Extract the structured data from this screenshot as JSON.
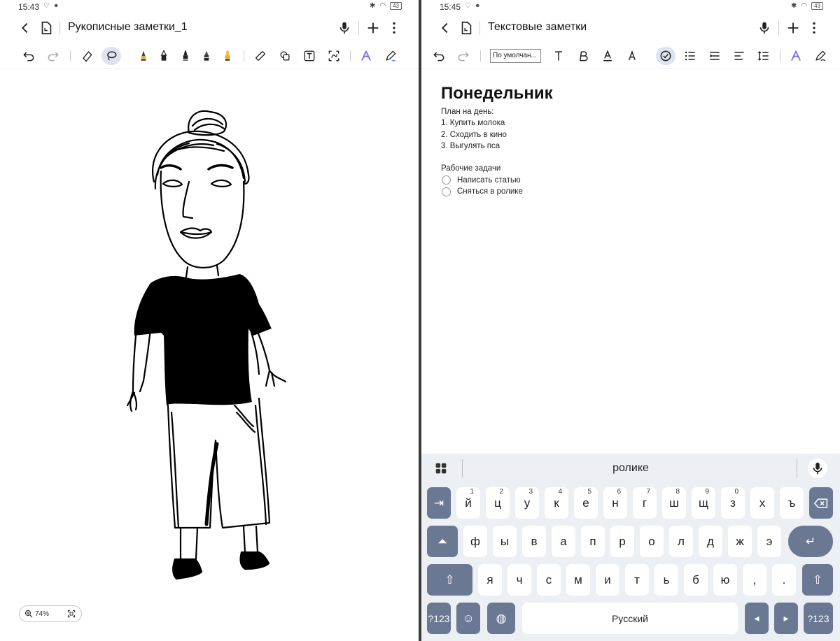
{
  "left": {
    "status": {
      "time": "15:43",
      "battery": "43"
    },
    "title": "Рукописные заметки_1",
    "zoom": "74%"
  },
  "right": {
    "status": {
      "time": "15:45",
      "battery": "43"
    },
    "title": "Текстовые заметки",
    "font_select": "По умолчан...",
    "doc": {
      "heading": "Понедельник",
      "lines": [
        "План на день:",
        "1. Купить молока",
        "2. Сходить в кино",
        "3. Выгулять пса"
      ],
      "section": "Рабочие задачи",
      "tasks": [
        "Написать статью",
        "Сняться в ролике"
      ]
    },
    "keyboard": {
      "suggestion": "ролике",
      "row1": [
        {
          "k": "й",
          "n": "1"
        },
        {
          "k": "ц",
          "n": "2"
        },
        {
          "k": "у",
          "n": "3"
        },
        {
          "k": "к",
          "n": "4"
        },
        {
          "k": "е",
          "n": "5"
        },
        {
          "k": "н",
          "n": "6"
        },
        {
          "k": "г",
          "n": "7"
        },
        {
          "k": "ш",
          "n": "8"
        },
        {
          "k": "щ",
          "n": "9"
        },
        {
          "k": "з",
          "n": "0"
        },
        {
          "k": "х",
          "n": ""
        },
        {
          "k": "ъ",
          "n": ""
        }
      ],
      "row2": [
        "ф",
        "ы",
        "в",
        "а",
        "п",
        "р",
        "о",
        "л",
        "д",
        "ж",
        "э"
      ],
      "row3": [
        "я",
        "ч",
        "с",
        "м",
        "и",
        "т",
        "ь",
        "б",
        "ю",
        ",",
        "."
      ],
      "numbers_key": "?123",
      "space_label": "Русский"
    }
  }
}
